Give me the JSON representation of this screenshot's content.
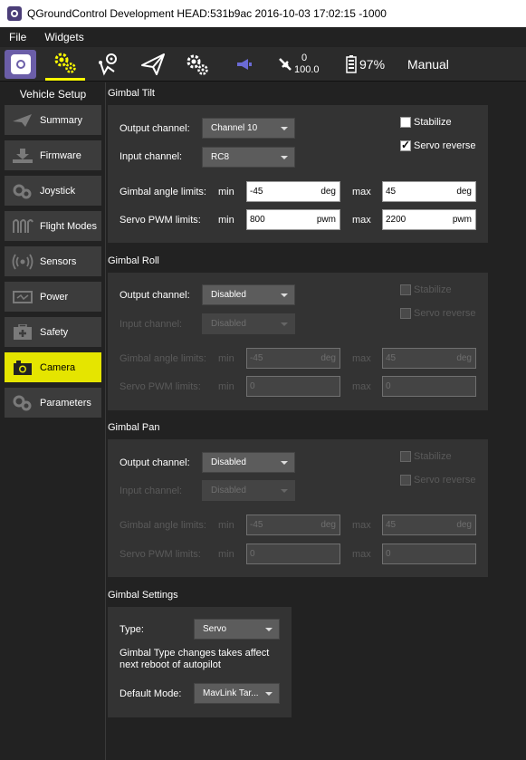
{
  "window": {
    "title": "QGroundControl Development HEAD:531b9ac 2016-10-03 17:02:15 -1000"
  },
  "menubar": {
    "file": "File",
    "widgets": "Widgets"
  },
  "toolbar": {
    "icons": [
      "qgc-logo-icon",
      "vehicle-setup-icon",
      "plan-icon",
      "fly-icon",
      "analyze-icon",
      "message-icon",
      "gps-icon",
      "battery-icon"
    ],
    "gps_count": "0",
    "gps_hdop": "100.0",
    "battery": "97%",
    "flight_mode": "Manual",
    "accent_color": "#ffff00"
  },
  "sidebar": {
    "header": "Vehicle Setup",
    "items": [
      {
        "label": "Summary",
        "icon": "plane-icon"
      },
      {
        "label": "Firmware",
        "icon": "download-icon"
      },
      {
        "label": "Joystick",
        "icon": "gamepad-icon"
      },
      {
        "label": "Flight Modes",
        "icon": "waves-icon"
      },
      {
        "label": "Sensors",
        "icon": "radio-wave-icon"
      },
      {
        "label": "Power",
        "icon": "power-icon"
      },
      {
        "label": "Safety",
        "icon": "first-aid-icon"
      },
      {
        "label": "Camera",
        "icon": "camera-icon"
      },
      {
        "label": "Parameters",
        "icon": "gears-icon"
      }
    ],
    "active": "Camera",
    "active_color": "#e5e500"
  },
  "tilt": {
    "title": "Gimbal Tilt",
    "output_label": "Output channel:",
    "output_value": "Channel 10",
    "input_label": "Input channel:",
    "input_value": "RC8",
    "stabilize": "Stabilize",
    "stabilize_checked": false,
    "servo_reverse": "Servo reverse",
    "servo_reverse_checked": true,
    "angle_label": "Gimbal angle limits:",
    "pwm_label": "Servo PWM limits:",
    "min": "min",
    "max": "max",
    "angle_min": "-45",
    "angle_max": "45",
    "angle_unit": "deg",
    "pwm_min": "800",
    "pwm_max": "2200",
    "pwm_unit": "pwm"
  },
  "roll": {
    "title": "Gimbal Roll",
    "output_label": "Output channel:",
    "output_value": "Disabled",
    "input_label": "Input channel:",
    "input_value": "Disabled",
    "stabilize": "Stabilize",
    "servo_reverse": "Servo reverse",
    "angle_label": "Gimbal angle limits:",
    "pwm_label": "Servo PWM limits:",
    "min": "min",
    "max": "max",
    "angle_min": "-45",
    "angle_max": "45",
    "angle_unit": "deg",
    "pwm_min": "0",
    "pwm_max": "0"
  },
  "pan": {
    "title": "Gimbal Pan",
    "output_label": "Output channel:",
    "output_value": "Disabled",
    "input_label": "Input channel:",
    "input_value": "Disabled",
    "stabilize": "Stabilize",
    "servo_reverse": "Servo reverse",
    "angle_label": "Gimbal angle limits:",
    "pwm_label": "Servo PWM limits:",
    "min": "min",
    "max": "max",
    "angle_min": "-45",
    "angle_max": "45",
    "angle_unit": "deg",
    "pwm_min": "0",
    "pwm_max": "0"
  },
  "settings": {
    "title": "Gimbal Settings",
    "type_label": "Type:",
    "type_value": "Servo",
    "note_line1": "Gimbal Type changes takes affect",
    "note_line2": "next reboot of autopilot",
    "mode_label": "Default Mode:",
    "mode_value": "MavLink Tar..."
  }
}
